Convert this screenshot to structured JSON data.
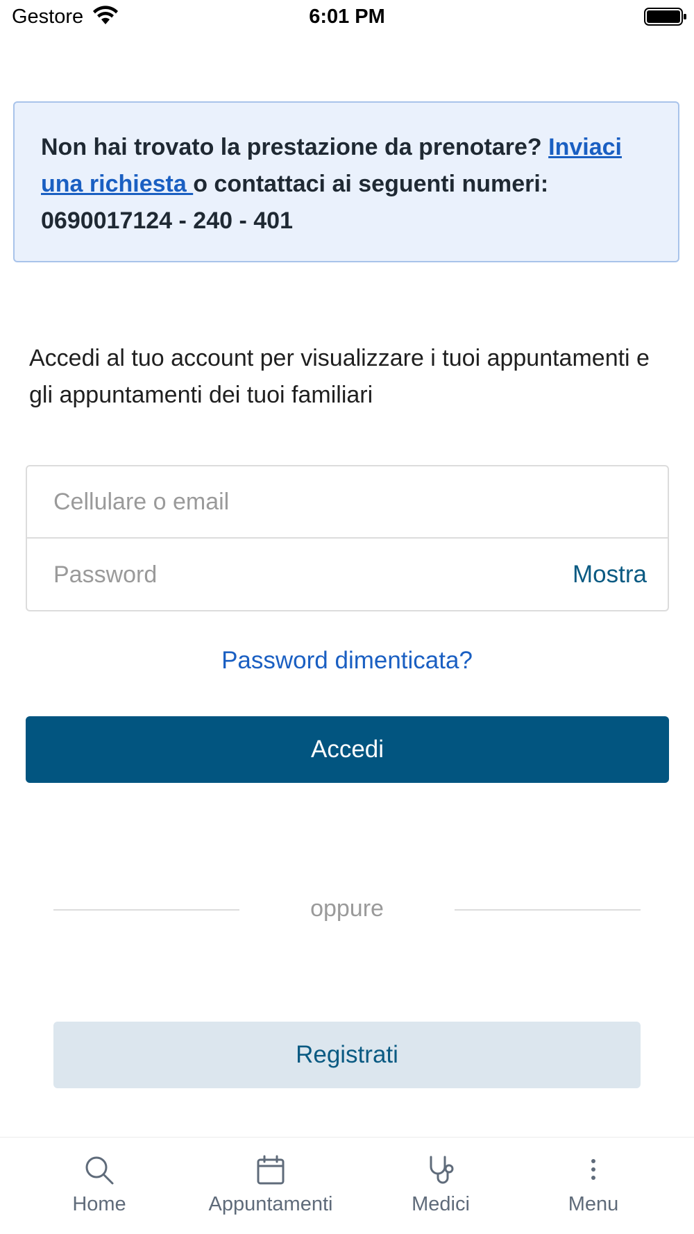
{
  "status_bar": {
    "carrier": "Gestore",
    "time": "6:01 PM"
  },
  "info_box": {
    "text_before": "Non hai trovato la prestazione da prenotare? ",
    "link_text": "Inviaci una richiesta ",
    "text_after": "o contattaci ai seguenti numeri: 0690017124 - 240 - 401"
  },
  "intro": {
    "text": "Accedi al tuo account per visualizzare i tuoi appuntamenti e gli appuntamenti dei tuoi familiari"
  },
  "login_form": {
    "username_placeholder": "Cellulare o email",
    "username_value": "",
    "password_placeholder": "Password",
    "password_value": "",
    "show_label": "Mostra",
    "forgot_label": "Password dimenticata?",
    "submit_label": "Accedi"
  },
  "divider": {
    "label": "oppure"
  },
  "register": {
    "label": "Registrati"
  },
  "tab_bar": {
    "items": [
      {
        "label": "Home",
        "icon": "search-icon"
      },
      {
        "label": "Appuntamenti",
        "icon": "calendar-icon"
      },
      {
        "label": "Medici",
        "icon": "stethoscope-icon"
      },
      {
        "label": "Menu",
        "icon": "more-vertical-icon"
      }
    ]
  },
  "colors": {
    "primary": "#025580",
    "link": "#1a5fc2",
    "info_background": "#eaf1fc",
    "info_border": "#a8c3ea",
    "secondary_button": "#dce6ee"
  }
}
